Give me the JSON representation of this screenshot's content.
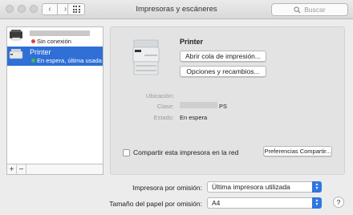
{
  "window": {
    "title": "Impresoras y escáneres"
  },
  "toolbar": {
    "back_icon": "chevron-left-icon",
    "forward_icon": "chevron-right-icon",
    "grid_icon": "show-all-icon"
  },
  "search": {
    "placeholder": "Buscar"
  },
  "printers": [
    {
      "name": "",
      "status": "Sin conexión",
      "status_color": "#e0443a"
    },
    {
      "name": "Printer",
      "status": "En espera, última usada",
      "status_color": "#3cc04a"
    }
  ],
  "list_controls": {
    "add": "+",
    "remove": "−"
  },
  "detail": {
    "printer_name": "Printer",
    "open_queue_label": "Abrir cola de impresión...",
    "options_label": "Opciones y recambios...",
    "location_label": "Ubicación:",
    "location_value": "",
    "kind_label": "Clase:",
    "kind_value": "PS",
    "status_label": "Estado:",
    "status_value": "En espera",
    "share_label": "Compartir esta impresora en la red",
    "share_checked": false,
    "prefs_label": "Preferencias Compartir..."
  },
  "defaults": {
    "default_printer_label": "Impresora por omisión:",
    "default_printer_value": "Última impresora utilizada",
    "paper_size_label": "Tamaño del papel por omisión:",
    "paper_size_value": "A4"
  },
  "colors": {
    "accent": "#2f6fd6",
    "offline": "#e0443a",
    "idle": "#3cc04a"
  }
}
